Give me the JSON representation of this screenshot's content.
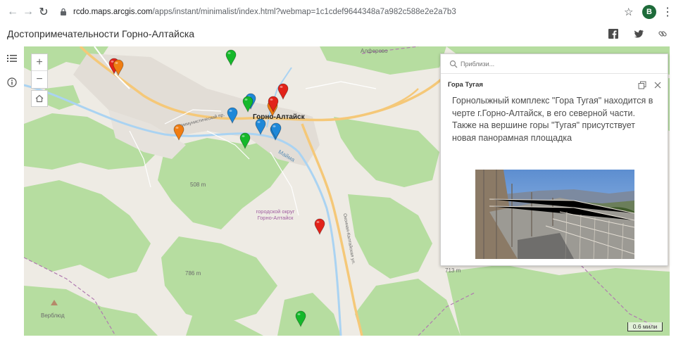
{
  "browser": {
    "url_domain": "rcdo.maps.arcgis.com",
    "url_path": "/apps/instant/minimalist/index.html?webmap=1c1cdef9644348a7a982c588e2e2a7b3",
    "profile_initial": "B"
  },
  "header": {
    "title": "Достопримечательности Горно-Алтайска",
    "share_icons": [
      "facebook-icon",
      "twitter-icon",
      "link-icon"
    ]
  },
  "rail": {
    "icons": [
      "layer-list-icon",
      "info-icon"
    ]
  },
  "map": {
    "city_label": "Горно-Алтайск",
    "region_label_line1": "городской округ",
    "region_label_line2": "Горно-Алтайск",
    "labels": {
      "alferovo": "Алферово",
      "elev1": "508 m",
      "elev2": "786 m",
      "elev3": "713 m",
      "verblyud": "Верблюд",
      "maima": "Майма",
      "road1": "Коммунистический пр.",
      "road2": "Оконная-Калтайская ул."
    },
    "scale": "0.6 мили",
    "zoom_in": "+",
    "zoom_out": "−",
    "pins": [
      {
        "color": "#e2231a"
      },
      {
        "color": "#f07d12"
      },
      {
        "color": "#15b82a"
      },
      {
        "color": "#f07d12"
      },
      {
        "color": "#e2231a"
      },
      {
        "color": "#15b82a"
      },
      {
        "color": "#1e88d8"
      },
      {
        "color": "#1e88d8"
      },
      {
        "color": "#f07d12"
      },
      {
        "color": "#1e88d8"
      },
      {
        "color": "#1e88d8"
      },
      {
        "color": "#e2231a"
      },
      {
        "color": "#15b82a"
      },
      {
        "color": "#1e88d8"
      },
      {
        "color": "#e2231a"
      },
      {
        "color": "#15b82a"
      }
    ]
  },
  "panel": {
    "search_placeholder": "Приблизи...",
    "popup_title": "Гора Тугая",
    "popup_text": "Горнолыжный комплекс \"Гора Тугая\" находится в черте г.Горно-Алтайск, в его северной части. Также на вершине горы \"Тугая\" присутствует новая панорамная площадка"
  },
  "colors": {
    "map_bg": "#eeebe4",
    "forest": "#b6dda0",
    "river": "#aad3f2",
    "road_major": "#f5c878"
  }
}
